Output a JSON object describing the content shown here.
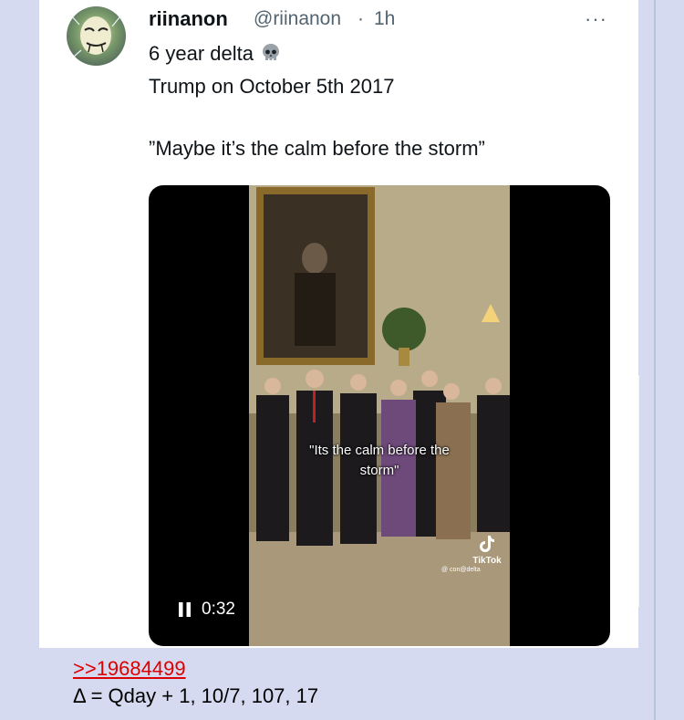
{
  "tweet": {
    "username": "riinanon",
    "handle": "@riinanon",
    "separator": "·",
    "time": "1h",
    "more_icon": "more-dots-icon",
    "lines": [
      "6 year delta",
      "Trump on October 5th 2017",
      "”Maybe it’s the calm before the storm”"
    ],
    "emoji": "skull-icon"
  },
  "video": {
    "duration": "0:32",
    "caption_line1": "\"Its the calm before the",
    "caption_line2": "storm\"",
    "watermark_brand": "TikTok",
    "watermark_handle": "@ con@delta"
  },
  "post": {
    "quote_link": ">>19684499",
    "text": "Δ = Qday + 1, 10/7, 107, 17"
  },
  "colors": {
    "board_bg": "#d6daf0",
    "link": "#dd0000",
    "tweet_text": "#0f1419",
    "tweet_meta": "#536471"
  }
}
